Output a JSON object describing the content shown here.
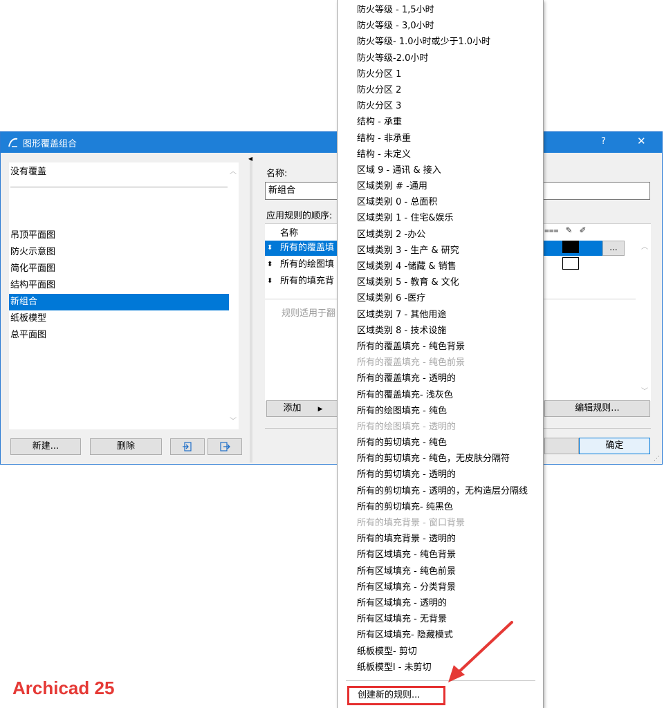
{
  "window": {
    "title": "图形覆盖组合",
    "help_label": "?",
    "close_label": "✕"
  },
  "left_panel": {
    "no_override": "没有覆盖",
    "combinations": [
      {
        "label": "吊顶平面图",
        "selected": false
      },
      {
        "label": "防火示意图",
        "selected": false
      },
      {
        "label": "简化平面图",
        "selected": false
      },
      {
        "label": "结构平面图",
        "selected": false
      },
      {
        "label": "新组合",
        "selected": true
      },
      {
        "label": "纸板模型",
        "selected": false
      },
      {
        "label": "总平面图",
        "selected": false
      }
    ],
    "new_button": "新建...",
    "delete_button": "删除"
  },
  "right_panel": {
    "name_label": "名称:",
    "name_value": "新组合",
    "order_label": "应用规则的顺序:",
    "column_name": "名称",
    "rules": [
      {
        "name": "所有的覆盖填",
        "selected": true
      },
      {
        "name": "所有的绘图填",
        "selected": false
      },
      {
        "name": "所有的填充背",
        "selected": false
      }
    ],
    "hint_text": "规则适用于翻",
    "add_button": "添加",
    "edit_rule_button": "编辑规则...",
    "ok_button": "确定",
    "dots_button": "..."
  },
  "menu": {
    "items": [
      {
        "label": "防火等级 - 1,5小时",
        "disabled": false
      },
      {
        "label": "防火等级 - 3,0小时",
        "disabled": false
      },
      {
        "label": "防火等级- 1.0小时或少于1.0小时",
        "disabled": false
      },
      {
        "label": "防火等级-2.0小时",
        "disabled": false
      },
      {
        "label": "防火分区 1",
        "disabled": false
      },
      {
        "label": "防火分区 2",
        "disabled": false
      },
      {
        "label": "防火分区 3",
        "disabled": false
      },
      {
        "label": "结构 - 承重",
        "disabled": false
      },
      {
        "label": "结构 - 非承重",
        "disabled": false
      },
      {
        "label": "结构 - 未定义",
        "disabled": false
      },
      {
        "label": "区域 9 - 通讯 & 接入",
        "disabled": false
      },
      {
        "label": "区域类别 # -通用",
        "disabled": false
      },
      {
        "label": "区域类别 0 - 总面积",
        "disabled": false
      },
      {
        "label": "区域类别 1 - 住宅&娱乐",
        "disabled": false
      },
      {
        "label": "区域类别 2 -办公",
        "disabled": false
      },
      {
        "label": "区域类别 3 - 生产 & 研究",
        "disabled": false
      },
      {
        "label": "区域类别 4 -储藏 & 销售",
        "disabled": false
      },
      {
        "label": "区域类别 5 - 教育 & 文化",
        "disabled": false
      },
      {
        "label": "区域类别 6 -医疗",
        "disabled": false
      },
      {
        "label": "区域类别 7 - 其他用途",
        "disabled": false
      },
      {
        "label": "区域类别 8 - 技术设施",
        "disabled": false
      },
      {
        "label": "所有的覆盖填充 - 纯色背景",
        "disabled": false
      },
      {
        "label": "所有的覆盖填充 - 纯色前景",
        "disabled": true
      },
      {
        "label": "所有的覆盖填充 - 透明的",
        "disabled": false
      },
      {
        "label": "所有的覆盖填充- 浅灰色",
        "disabled": false
      },
      {
        "label": "所有的绘图填充 - 纯色",
        "disabled": false
      },
      {
        "label": "所有的绘图填充 - 透明的",
        "disabled": true
      },
      {
        "label": "所有的剪切填充 - 纯色",
        "disabled": false
      },
      {
        "label": "所有的剪切填充 - 纯色，无皮肤分隔符",
        "disabled": false
      },
      {
        "label": "所有的剪切填充 - 透明的",
        "disabled": false
      },
      {
        "label": "所有的剪切填充 - 透明的，无构造层分隔线",
        "disabled": false
      },
      {
        "label": "所有的剪切填充- 纯黑色",
        "disabled": false
      },
      {
        "label": "所有的填充背景 - 窗口背景",
        "disabled": true
      },
      {
        "label": "所有的填充背景 - 透明的",
        "disabled": false
      },
      {
        "label": "所有区域填充 - 纯色背景",
        "disabled": false
      },
      {
        "label": "所有区域填充 - 纯色前景",
        "disabled": false
      },
      {
        "label": "所有区域填充 - 分类背景",
        "disabled": false
      },
      {
        "label": "所有区域填充 - 透明的",
        "disabled": false
      },
      {
        "label": "所有区域填充 - 无背景",
        "disabled": false
      },
      {
        "label": "所有区域填充- 隐藏模式",
        "disabled": false
      },
      {
        "label": "纸板模型- 剪切",
        "disabled": false
      },
      {
        "label": "纸板模型l - 未剪切",
        "disabled": false
      }
    ],
    "create_rule": "创建新的规则..."
  },
  "annotation": {
    "brand_text": "Archicad  25",
    "color": "#e53935"
  },
  "colors": {
    "accent": "#0078d7",
    "titlebar": "#1e7fd8"
  }
}
